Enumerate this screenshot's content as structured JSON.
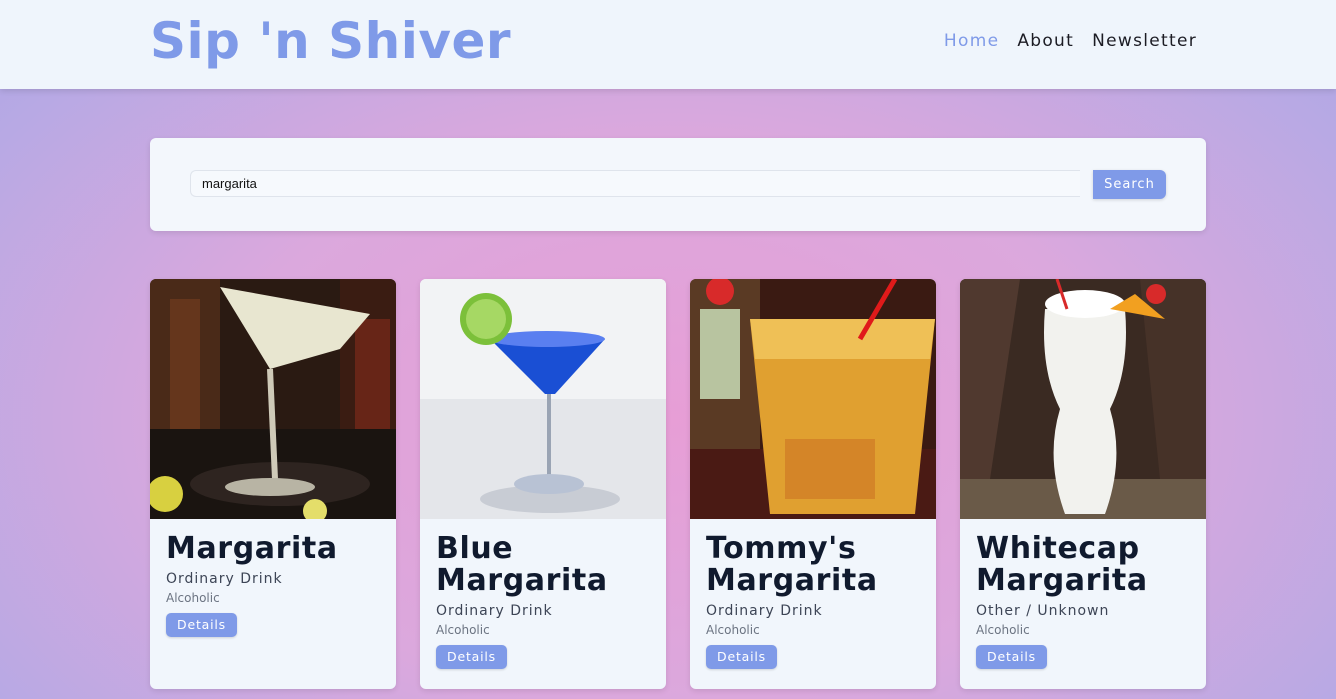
{
  "header": {
    "logo": "Sip 'n Shiver",
    "nav": [
      {
        "label": "Home",
        "active": true
      },
      {
        "label": "About",
        "active": false
      },
      {
        "label": "Newsletter",
        "active": false
      }
    ]
  },
  "search": {
    "value": "margarita",
    "button_label": "Search"
  },
  "drinks": [
    {
      "name": "Margarita",
      "category": "Ordinary Drink",
      "alcoholic": "Alcoholic",
      "details_label": "Details"
    },
    {
      "name": "Blue Margarita",
      "category": "Ordinary Drink",
      "alcoholic": "Alcoholic",
      "details_label": "Details"
    },
    {
      "name": "Tommy's Margarita",
      "category": "Ordinary Drink",
      "alcoholic": "Alcoholic",
      "details_label": "Details"
    },
    {
      "name": "Whitecap Margarita",
      "category": "Other / Unknown",
      "alcoholic": "Alcoholic",
      "details_label": "Details"
    }
  ],
  "colors": {
    "accent": "#7f9ae8",
    "navbar_bg": "#eff5fc",
    "card_bg": "#f1f6fc",
    "heading_text": "#101a2e"
  }
}
